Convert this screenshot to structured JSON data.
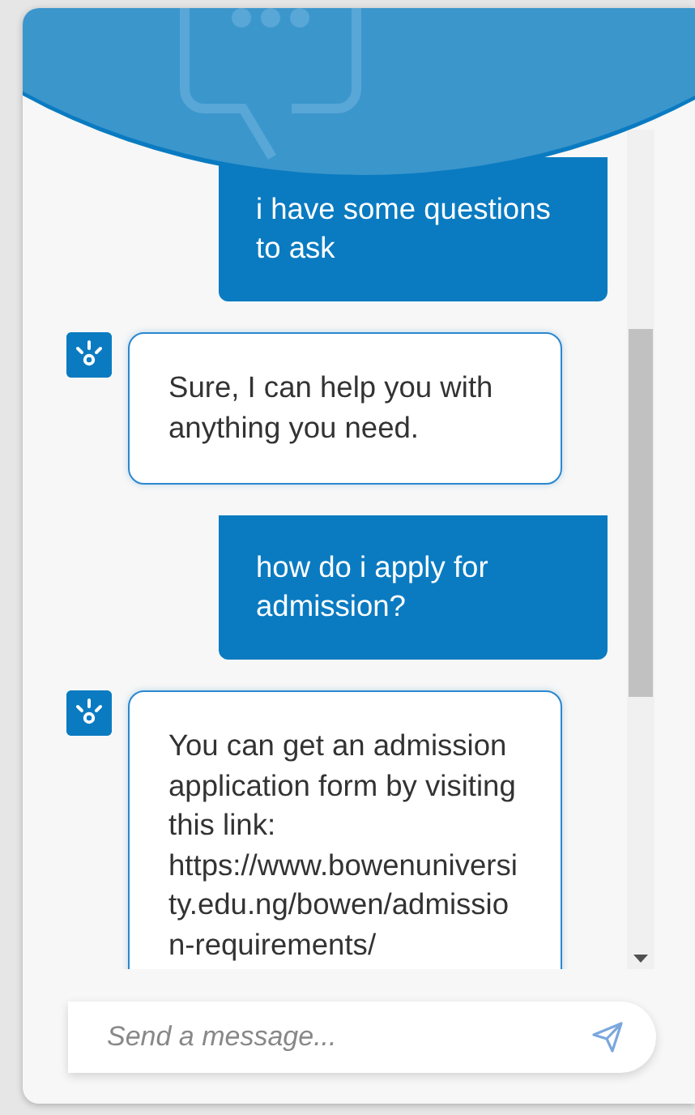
{
  "messages": [
    {
      "kind": "user",
      "text": "i have some questions to ask"
    },
    {
      "kind": "bot",
      "text": "Sure, I can help you with anything you need."
    },
    {
      "kind": "user",
      "text": "how do i apply for admission?"
    },
    {
      "kind": "bot",
      "text": "You can get an admission application form by visiting this link: https://www.bowenuniversity.edu.ng/bowen/admission-requirements/"
    }
  ],
  "composer": {
    "placeholder": "Send a message..."
  }
}
